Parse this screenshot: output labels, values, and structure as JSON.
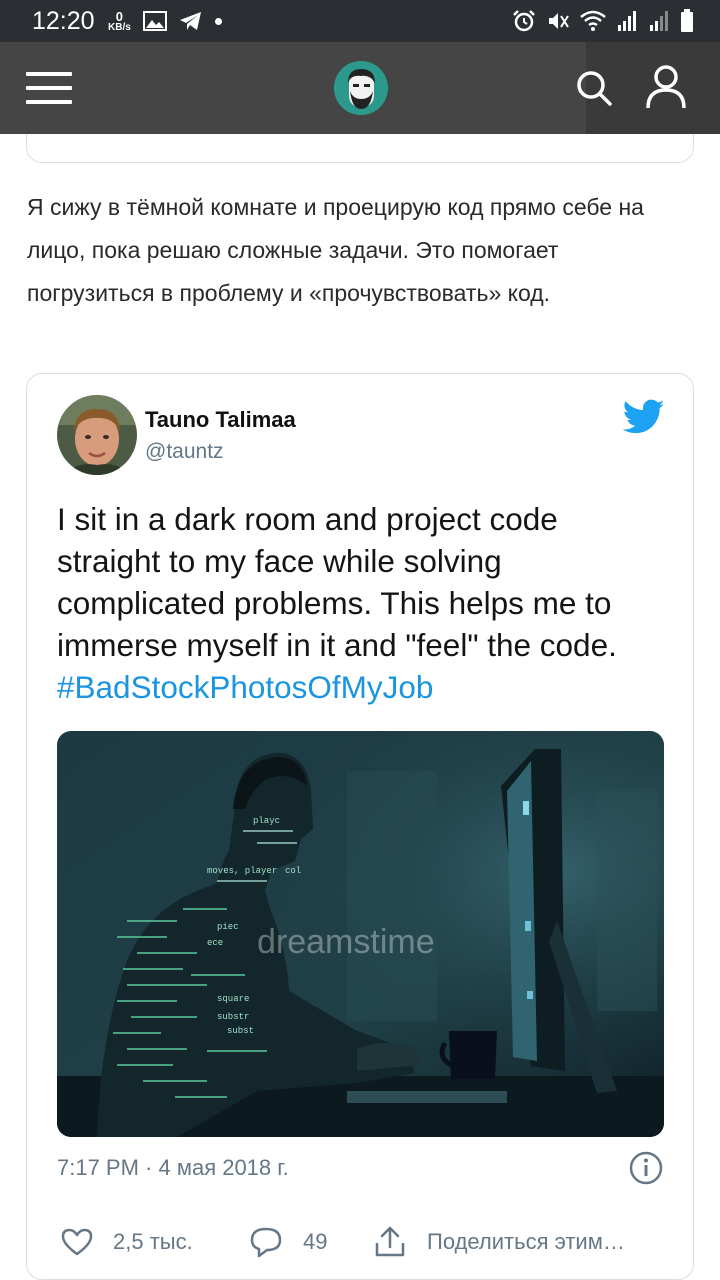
{
  "status_bar": {
    "time": "12:20",
    "net_speed_value": "0",
    "net_speed_unit": "KB/s"
  },
  "header": {
    "menu_icon": "hamburger-icon",
    "logo_icon": "bearded-face-logo",
    "search_icon": "search-icon",
    "user_icon": "user-icon"
  },
  "article": {
    "paragraph": "Я сижу в тёмной комнате и проецирую код прямо себе на лицо, пока решаю сложные задачи. Это помогает погрузиться в проблему и «прочувствовать» код."
  },
  "tweet": {
    "author_name": "Tauno Talimaa",
    "author_handle": "@tauntz",
    "text": "I sit in a dark room and project code straight to my face while solving complicated problems. This helps me to immerse myself in it and \"feel\" the code. ",
    "hashtag": "#BadStockPhotosOfMyJob",
    "photo_watermark": "dreamstime",
    "photo_code_snippets": [
      "playc",
      "moves, player",
      "col",
      "piec",
      "ece",
      "square",
      "substr",
      "subst"
    ],
    "timestamp": "7:17 PM · 4 мая 2018 г.",
    "likes": "2,5 тыс.",
    "replies": "49",
    "share_label": "Поделиться этим…"
  },
  "colors": {
    "status_bar": "#2b2e33",
    "header": "#454545",
    "logo_bg": "#2b9a8c",
    "hashtag": "#1b95e0",
    "twitter_blue": "#1da1f2",
    "meta_gray": "#657786"
  }
}
